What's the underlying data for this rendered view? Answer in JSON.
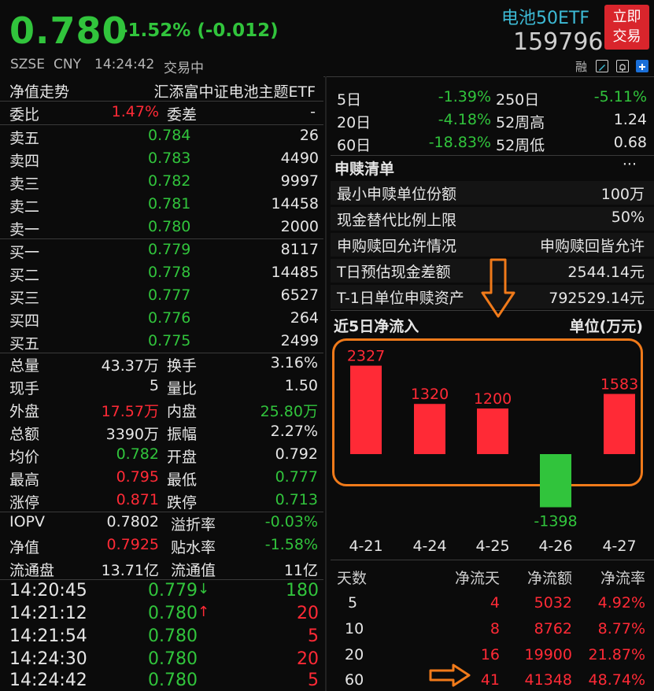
{
  "header": {
    "price": "0.780",
    "change": "-1.52% (-0.012)",
    "exchange": "SZSE",
    "currency": "CNY",
    "time": "14:24:42",
    "status": "交易中",
    "fund_name": "电池50ETF",
    "code": "159796",
    "trade_btn_line1": "立即",
    "trade_btn_line2": "交易",
    "margin_label": "融"
  },
  "left": {
    "nav_title": "净值走势",
    "fund_fullname": "汇添富中证电池主题ETF",
    "weibi_label": "委比",
    "weibi_value": "1.47%",
    "weicha_label": "委差",
    "weicha_value": "-",
    "sells": [
      {
        "label": "卖五",
        "price": "0.784",
        "vol": "26"
      },
      {
        "label": "卖四",
        "price": "0.783",
        "vol": "4490"
      },
      {
        "label": "卖三",
        "price": "0.782",
        "vol": "9997"
      },
      {
        "label": "卖二",
        "price": "0.781",
        "vol": "14458"
      },
      {
        "label": "卖一",
        "price": "0.780",
        "vol": "2000"
      }
    ],
    "buys": [
      {
        "label": "买一",
        "price": "0.779",
        "vol": "8117"
      },
      {
        "label": "买二",
        "price": "0.778",
        "vol": "14485"
      },
      {
        "label": "买三",
        "price": "0.777",
        "vol": "6527"
      },
      {
        "label": "买四",
        "price": "0.776",
        "vol": "264"
      },
      {
        "label": "买五",
        "price": "0.775",
        "vol": "2499"
      }
    ],
    "stats": [
      {
        "l1": "总量",
        "v1": "43.37万",
        "l2": "换手",
        "v2": "3.16%"
      },
      {
        "l1": "现手",
        "v1": "5",
        "l2": "量比",
        "v2": "1.50"
      },
      {
        "l1": "外盘",
        "v1": "17.57万",
        "l2": "内盘",
        "v2": "25.80万"
      },
      {
        "l1": "总额",
        "v1": "3390万",
        "l2": "振幅",
        "v2": "2.27%"
      },
      {
        "l1": "均价",
        "v1": "0.782",
        "l2": "开盘",
        "v2": "0.792"
      },
      {
        "l1": "最高",
        "v1": "0.795",
        "l2": "最低",
        "v2": "0.777"
      },
      {
        "l1": "涨停",
        "v1": "0.871",
        "l2": "跌停",
        "v2": "0.713"
      }
    ],
    "iopv": [
      {
        "l1": "IOPV",
        "v1": "0.7802",
        "l2": "溢折率",
        "v2": "-0.03%"
      },
      {
        "l1": "净值",
        "v1": "0.7925",
        "l2": "贴水率",
        "v2": "-1.58%"
      },
      {
        "l1": "流通盘",
        "v1": "13.71亿",
        "l2": "流通值",
        "v2": "11亿"
      }
    ],
    "ticks": [
      {
        "time": "14:20:45",
        "price": "0.779",
        "arrow": "↓",
        "vol": "180"
      },
      {
        "time": "14:21:12",
        "price": "0.780",
        "arrow": "↑",
        "vol": "20"
      },
      {
        "time": "14:21:54",
        "price": "0.780",
        "arrow": "",
        "vol": "5"
      },
      {
        "time": "14:24:30",
        "price": "0.780",
        "arrow": "",
        "vol": "20"
      },
      {
        "time": "14:24:42",
        "price": "0.780",
        "arrow": "",
        "vol": "5"
      }
    ]
  },
  "right": {
    "perf": [
      {
        "l1": "5日",
        "v1": "-1.39%",
        "l2": "250日",
        "v2": "-5.11%"
      },
      {
        "l1": "20日",
        "v1": "-4.18%",
        "l2": "52周高",
        "v2": "1.24"
      },
      {
        "l1": "60日",
        "v1": "-18.83%",
        "l2": "52周低",
        "v2": "0.68"
      }
    ],
    "creation_title": "申赎清单",
    "creation_more": "···",
    "creation": [
      {
        "label": "最小申赎单位份额",
        "value": "100万"
      },
      {
        "label": "现金替代比例上限",
        "value": "50%"
      },
      {
        "label": "申购赎回允许情况",
        "value": "申购赎回皆允许"
      },
      {
        "label": "T日预估现金差额",
        "value": "2544.14元"
      },
      {
        "label": "T-1日单位申赎资产",
        "value": "792529.14元"
      }
    ],
    "flow_title": "近5日净流入",
    "flow_unit": "单位(万元)",
    "flow_table_headers": [
      "天数",
      "净流天",
      "净流额",
      "净流率"
    ],
    "flow_table": [
      {
        "days": "5",
        "flow_days": "4",
        "amount": "5032",
        "rate": "4.92%"
      },
      {
        "days": "10",
        "flow_days": "8",
        "amount": "8762",
        "rate": "8.77%"
      },
      {
        "days": "20",
        "flow_days": "16",
        "amount": "19900",
        "rate": "21.87%"
      },
      {
        "days": "60",
        "flow_days": "41",
        "amount": "41348",
        "rate": "48.74%"
      }
    ]
  },
  "colors": {
    "up": "#ff2a36",
    "down": "#31c43c",
    "accent": "#f07a1a",
    "name": "#3dbbd6"
  },
  "icons": [
    "edit-icon",
    "bell-icon",
    "add-icon",
    "down-arrow-icon",
    "up-arrow-icon"
  ],
  "chart_data": {
    "type": "bar",
    "categories": [
      "4-21",
      "4-24",
      "4-25",
      "4-26",
      "4-27"
    ],
    "values": [
      2327,
      1320,
      1200,
      -1398,
      1583
    ],
    "title": "近5日净流入",
    "ylabel": "单位(万元)"
  }
}
